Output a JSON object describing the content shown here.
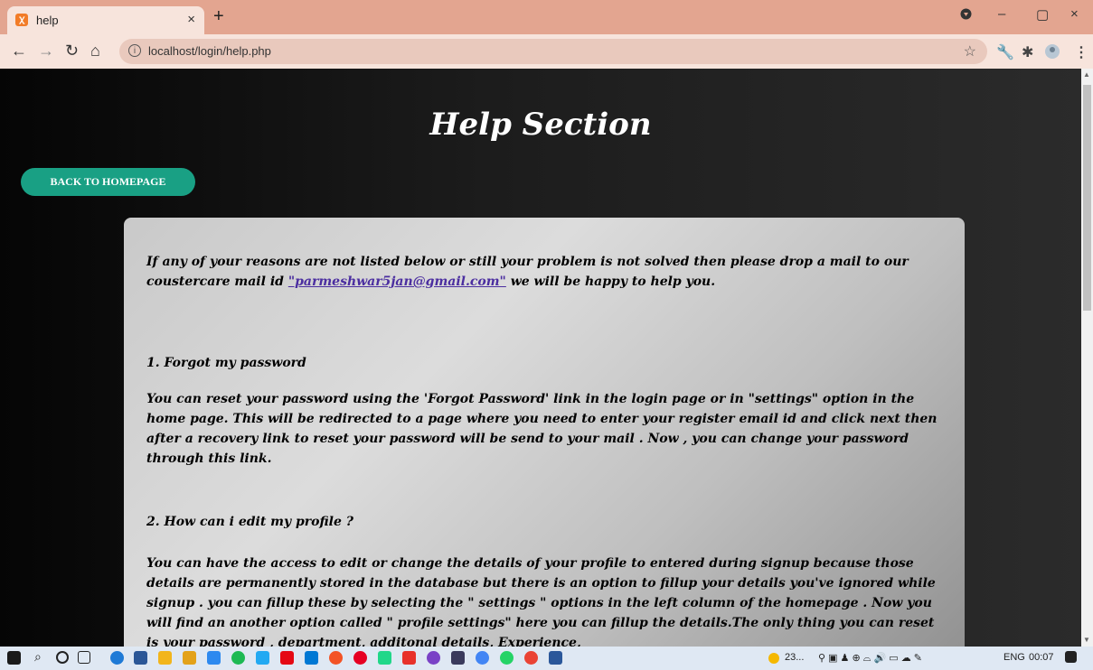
{
  "browser": {
    "tab_title": "help",
    "tab_favicon": "xampp-icon",
    "url": "localhost/login/help.php",
    "window_controls": {
      "minimize": "–",
      "maximize": "▢",
      "close": "×"
    }
  },
  "page": {
    "heading": "Help Section",
    "back_button": "BACK TO HOMEPAGE",
    "intro_before": "If any of your reasons are not listed below or still your problem is not solved then please drop a mail to our coustercare mail id ",
    "email": "\"parmeshwar5jan@gmail.com\"",
    "intro_after": " we will be happy to help you.",
    "faq": [
      {
        "question": "1. Forgot my password",
        "answer": "You can reset your password using the 'Forgot Password' link in the login page or in \"settings\" option in the home page. This will be redirected to a page where you need to enter your register email id and click next then after a recovery link to reset your password will be send to your mail . Now , you can change your password through this link."
      },
      {
        "question": "2. How can i edit my profile ?",
        "answer": "You can have the access to edit or change the details of your profile to entered during signup because those details are permanently stored in the database but there is an option to fillup your details you've ignored while signup . you can fillup these by selecting the \" settings \" options in the left column of the homepage . Now you will find an another option called \" profile settings\" here you can fillup the details.The only thing you can reset is your password , department, additonal details, Experience,"
      }
    ]
  },
  "taskbar": {
    "weather": "23...",
    "language": "ENG",
    "time": "00:07"
  }
}
